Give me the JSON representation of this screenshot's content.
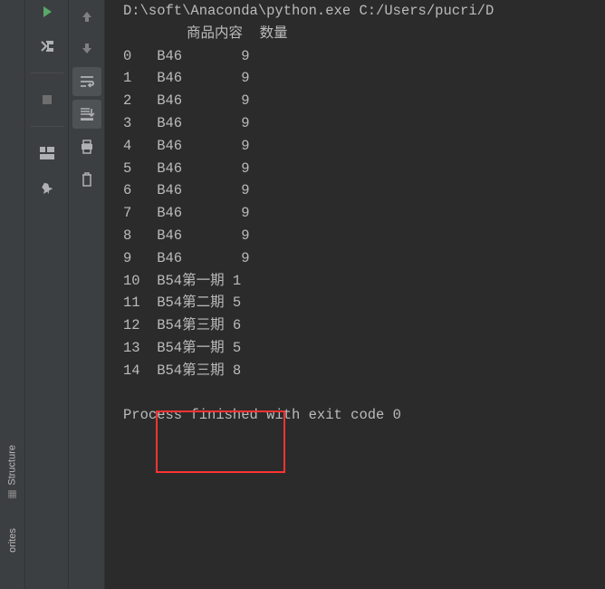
{
  "command_line": "D:\\soft\\Anaconda\\python.exe C:/Users/pucri/D",
  "columns": {
    "content": "商品内容",
    "quantity": "数量"
  },
  "rows": [
    {
      "idx": "0",
      "content": "B46",
      "qty": "9"
    },
    {
      "idx": "1",
      "content": "B46",
      "qty": "9"
    },
    {
      "idx": "2",
      "content": "B46",
      "qty": "9"
    },
    {
      "idx": "3",
      "content": "B46",
      "qty": "9"
    },
    {
      "idx": "4",
      "content": "B46",
      "qty": "9"
    },
    {
      "idx": "5",
      "content": "B46",
      "qty": "9"
    },
    {
      "idx": "6",
      "content": "B46",
      "qty": "9"
    },
    {
      "idx": "7",
      "content": "B46",
      "qty": "9"
    },
    {
      "idx": "8",
      "content": "B46",
      "qty": "9"
    },
    {
      "idx": "9",
      "content": "B46",
      "qty": "9"
    },
    {
      "idx": "10",
      "content": "B54第一期",
      "qty": "1"
    },
    {
      "idx": "11",
      "content": "B54第二期",
      "qty": "5"
    },
    {
      "idx": "12",
      "content": "B54第三期",
      "qty": "6"
    },
    {
      "idx": "13",
      "content": "B54第一期",
      "qty": "5"
    },
    {
      "idx": "14",
      "content": "B54第三期",
      "qty": "8"
    }
  ],
  "exit_message": "Process finished with exit code 0",
  "sidebar": {
    "structure": "Structure",
    "favorites": "orites"
  },
  "chart_data": {
    "type": "table",
    "title": "Console output dataframe",
    "columns": [
      "商品内容",
      "数量"
    ],
    "data": [
      [
        "B46",
        9
      ],
      [
        "B46",
        9
      ],
      [
        "B46",
        9
      ],
      [
        "B46",
        9
      ],
      [
        "B46",
        9
      ],
      [
        "B46",
        9
      ],
      [
        "B46",
        9
      ],
      [
        "B46",
        9
      ],
      [
        "B46",
        9
      ],
      [
        "B46",
        9
      ],
      [
        "B54第一期",
        1
      ],
      [
        "B54第二期",
        5
      ],
      [
        "B54第三期",
        6
      ],
      [
        "B54第一期",
        5
      ],
      [
        "B54第三期",
        8
      ]
    ]
  }
}
